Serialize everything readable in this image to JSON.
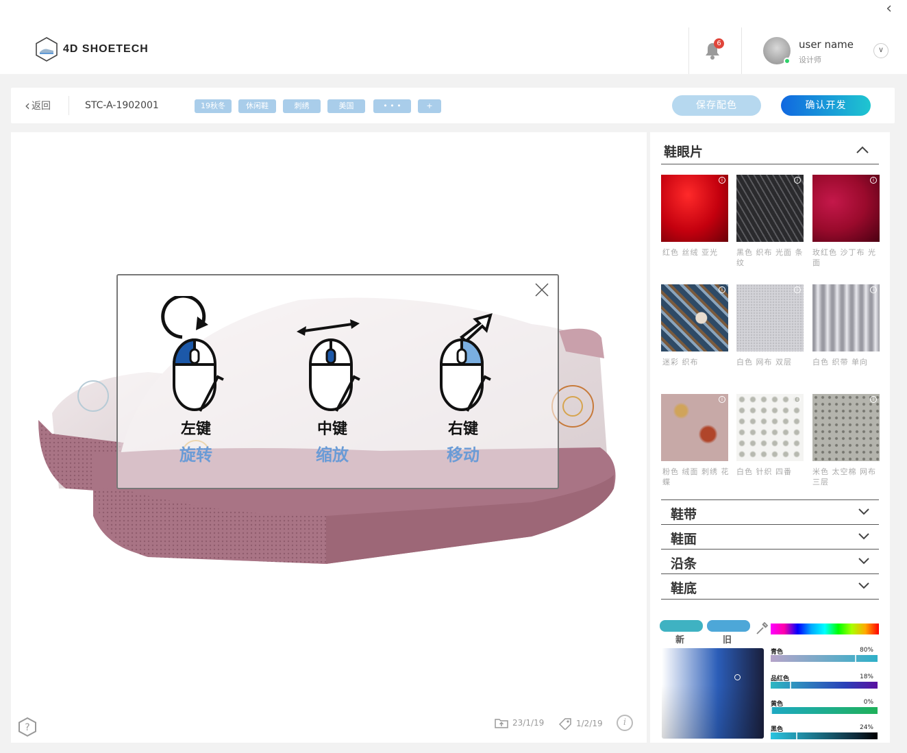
{
  "header": {
    "logo_text": "4D SHOETECH",
    "notification_count": "6",
    "user_name": "user name",
    "user_role": "设计师"
  },
  "toolbar": {
    "back_label": "返回",
    "product_code": "STC-A-1902001",
    "tags": [
      "19秋冬",
      "休闲鞋",
      "刺绣",
      "美国",
      "• • •",
      "+"
    ],
    "save_label": "保存配色",
    "confirm_label": "确认开发"
  },
  "viewer": {
    "overlay": {
      "controls": [
        {
          "key": "左键",
          "action": "旋转",
          "icon": "rotate-icon"
        },
        {
          "key": "中键",
          "action": "缩放",
          "icon": "zoom-icon"
        },
        {
          "key": "右键",
          "action": "移动",
          "icon": "move-icon"
        }
      ]
    },
    "status": {
      "date_1": "23/1/19",
      "date_2": "1/2/19"
    },
    "info_glyph": "i",
    "help_glyph": "?"
  },
  "panel": {
    "section_title": "鞋眼片",
    "swatches": [
      {
        "label": "红色  丝绒  亚光",
        "color": "#c4000e"
      },
      {
        "label": "黑色  织布  光面  条纹",
        "color": "#3a3a3d"
      },
      {
        "label": "玫红色  沙丁布  光面",
        "color": "#9a0a2c"
      },
      {
        "label": "迷彩  织布",
        "color": "#3d5a78"
      },
      {
        "label": "白色  网布  双层",
        "color": "#c9c9ce"
      },
      {
        "label": "白色  织带  单向",
        "color": "#b7b7bc"
      },
      {
        "label": "粉色  绒面  刺绣  花蝶",
        "color": "#c7a9a7"
      },
      {
        "label": "白色  针织   四番",
        "color": "#e8e8e6"
      },
      {
        "label": "米色  太空棉  网布  三层",
        "color": "#b4b4ad"
      }
    ],
    "accordions": [
      "鞋带",
      "鞋面",
      "沿条",
      "鞋底"
    ],
    "picker": {
      "new_label": "新",
      "old_label": "旧",
      "new_color": "#3fb2c2",
      "old_color": "#4da7d8",
      "cmyk": [
        {
          "name": "青色",
          "value": "80%",
          "fraction": 0.8
        },
        {
          "name": "品红色",
          "value": "18%",
          "fraction": 0.18
        },
        {
          "name": "黄色",
          "value": "0%",
          "fraction": 0.0
        },
        {
          "name": "黑色",
          "value": "24%",
          "fraction": 0.24
        }
      ]
    }
  }
}
